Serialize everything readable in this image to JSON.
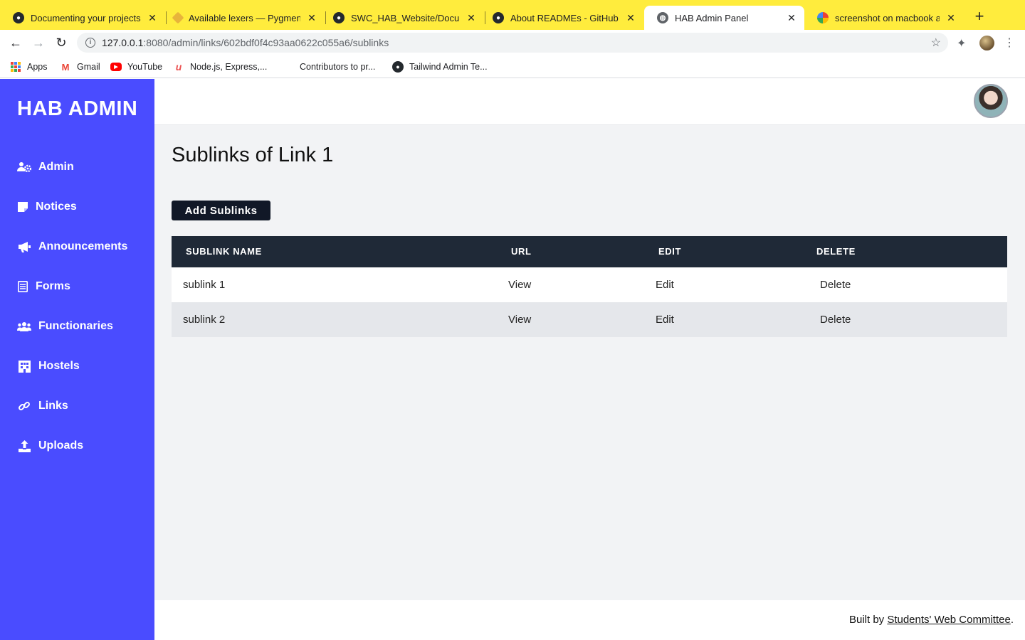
{
  "browser": {
    "tabs": [
      {
        "title": "Documenting your projects o",
        "icon": "github-icon",
        "active": false
      },
      {
        "title": "Available lexers — Pygments",
        "icon": "pygments-icon",
        "active": false
      },
      {
        "title": "SWC_HAB_Website/Docume",
        "icon": "github-icon",
        "active": false
      },
      {
        "title": "About READMEs - GitHub Do",
        "icon": "github-icon",
        "active": false
      },
      {
        "title": "HAB Admin Panel",
        "icon": "globe-icon",
        "active": true
      },
      {
        "title": "screenshot on macbook air",
        "icon": "google-icon",
        "active": false
      }
    ],
    "new_tab": "+",
    "url_host": "127.0.0.1",
    "url_rest": ":8080/admin/links/602bdf0f4c93aa0622c055a6/sublinks",
    "bookmarks": [
      {
        "label": "Apps",
        "icon": "apps-grid-icon"
      },
      {
        "label": "Gmail",
        "icon": "gmail-icon"
      },
      {
        "label": "YouTube",
        "icon": "youtube-icon"
      },
      {
        "label": "Node.js, Express,...",
        "icon": "udemy-icon"
      },
      {
        "label": "Contributors to pr...",
        "icon": "none"
      },
      {
        "label": "Tailwind Admin Te...",
        "icon": "github-icon"
      }
    ],
    "colors": {
      "tab_strip": "#ffec3d"
    }
  },
  "sidebar": {
    "brand": "HAB ADMIN",
    "items": [
      {
        "label": "Admin",
        "icon": "users-cog-icon"
      },
      {
        "label": "Notices",
        "icon": "sticky-note-icon"
      },
      {
        "label": "Announcements",
        "icon": "bullhorn-icon"
      },
      {
        "label": "Forms",
        "icon": "form-icon"
      },
      {
        "label": "Functionaries",
        "icon": "users-icon"
      },
      {
        "label": "Hostels",
        "icon": "building-icon"
      },
      {
        "label": "Links",
        "icon": "link-icon"
      },
      {
        "label": "Uploads",
        "icon": "upload-icon"
      }
    ],
    "color": "#4a4cff"
  },
  "main": {
    "title": "Sublinks of Link 1",
    "add_button": "Add Sublinks",
    "table": {
      "headers": [
        "SUBLINK NAME",
        "URL",
        "EDIT",
        "DELETE"
      ],
      "rows": [
        {
          "name": "sublink 1",
          "url": "View",
          "edit": "Edit",
          "delete": "Delete"
        },
        {
          "name": "sublink 2",
          "url": "View",
          "edit": "Edit",
          "delete": "Delete"
        }
      ]
    }
  },
  "footer": {
    "prefix": "Built by ",
    "link": "Students' Web Committee",
    "suffix": "."
  }
}
